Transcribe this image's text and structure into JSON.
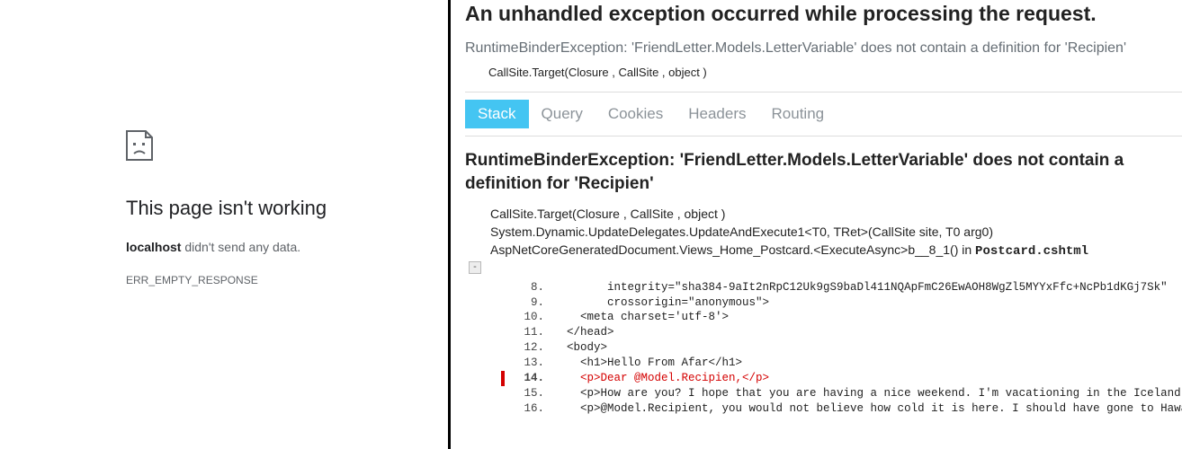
{
  "left": {
    "title": "This page isn't working",
    "host": "localhost",
    "desc_suffix": " didn't send any data.",
    "error_code": "ERR_EMPTY_RESPONSE"
  },
  "right": {
    "heading": "An unhandled exception occurred while processing the request.",
    "summary": "RuntimeBinderException: 'FriendLetter.Models.LetterVariable' does not contain a definition for 'Recipien'",
    "callsite_top": "CallSite.Target(Closure , CallSite , object )",
    "tabs": [
      {
        "label": "Stack",
        "active": true
      },
      {
        "label": "Query",
        "active": false
      },
      {
        "label": "Cookies",
        "active": false
      },
      {
        "label": "Headers",
        "active": false
      },
      {
        "label": "Routing",
        "active": false
      }
    ],
    "detail_heading": "RuntimeBinderException: 'FriendLetter.Models.LetterVariable' does not contain a definition for 'Recipien'",
    "frames": [
      "CallSite.Target(Closure , CallSite , object )",
      "System.Dynamic.UpdateDelegates.UpdateAndExecute1<T0, TRet>(CallSite site, T0 arg0)"
    ],
    "frame_with_file_prefix": "AspNetCoreGeneratedDocument.Views_Home_Postcard.<ExecuteAsync>b__8_1() in ",
    "frame_with_file_name": "Postcard.cshtml",
    "code": [
      {
        "n": 8,
        "t": "        integrity=\"sha384-9aIt2nRpC12Uk9gS9baDl411NQApFmC26EwAOH8WgZl5MYYxFfc+NcPb1dKGj7Sk\""
      },
      {
        "n": 9,
        "t": "        crossorigin=\"anonymous\">"
      },
      {
        "n": 10,
        "t": "    <meta charset='utf-8'>"
      },
      {
        "n": 11,
        "t": "  </head>"
      },
      {
        "n": 12,
        "t": "  <body>"
      },
      {
        "n": 13,
        "t": "    <h1>Hello From Afar</h1>"
      },
      {
        "n": 14,
        "t": "    <p>Dear @Model.Recipien,</p>",
        "hl": true
      },
      {
        "n": 15,
        "t": "    <p>How are you? I hope that you are having a nice weekend. I'm vacationing in the Iceland wh"
      },
      {
        "n": 16,
        "t": "    <p>@Model.Recipient, you would not believe how cold it is here. I should have gone to Hawaii"
      }
    ]
  }
}
